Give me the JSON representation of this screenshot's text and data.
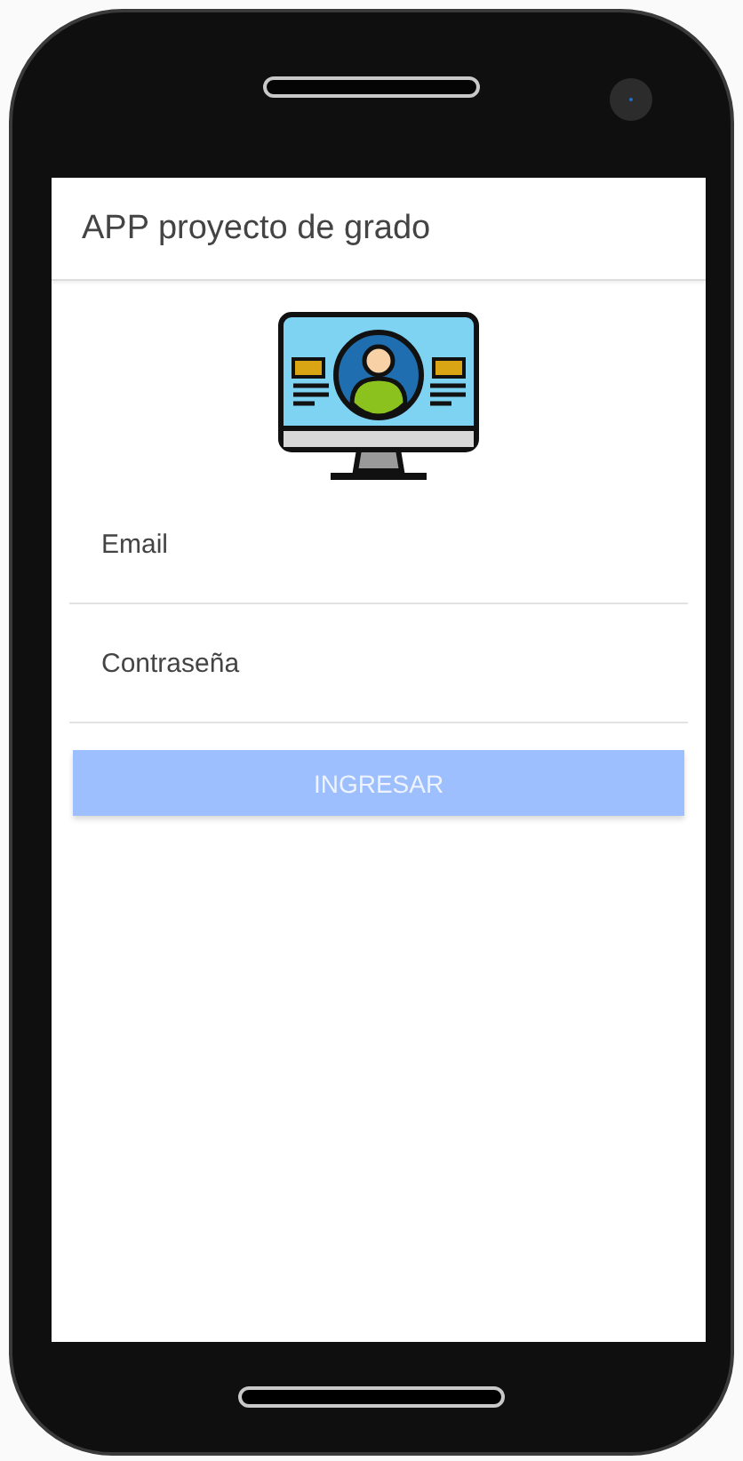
{
  "app_bar": {
    "title": "APP proyecto de grado"
  },
  "fields": [
    {
      "placeholder": "Email"
    },
    {
      "placeholder": "Contraseña"
    }
  ],
  "login_button": {
    "label": "INGRESAR",
    "disabled": true
  }
}
